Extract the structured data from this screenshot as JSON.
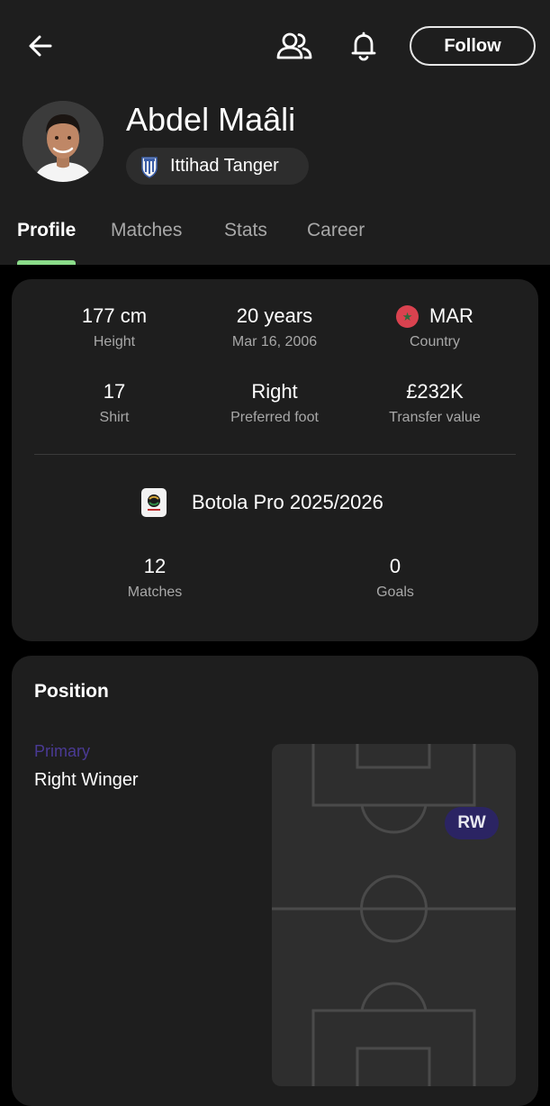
{
  "header": {
    "follow_label": "Follow",
    "player_name": "Abdel Maâli",
    "team_name": "Ittihad Tanger"
  },
  "tabs": [
    {
      "label": "Profile",
      "active": true
    },
    {
      "label": "Matches",
      "active": false
    },
    {
      "label": "Stats",
      "active": false
    },
    {
      "label": "Career",
      "active": false
    }
  ],
  "info": {
    "height": {
      "value": "177 cm",
      "label": "Height"
    },
    "age": {
      "value": "20 years",
      "label": "Mar 16, 2006"
    },
    "country": {
      "value": "MAR",
      "label": "Country"
    },
    "shirt": {
      "value": "17",
      "label": "Shirt"
    },
    "foot": {
      "value": "Right",
      "label": "Preferred foot"
    },
    "transfer": {
      "value": "£232K",
      "label": "Transfer value"
    },
    "league": {
      "name": "Botola Pro 2025/2026"
    },
    "matches": {
      "value": "12",
      "label": "Matches"
    },
    "goals": {
      "value": "0",
      "label": "Goals"
    }
  },
  "position": {
    "title": "Position",
    "primary_label": "Primary",
    "primary_position": "Right Winger",
    "badge": "RW"
  },
  "colors": {
    "background": "#000000",
    "surface": "#1e1e1e",
    "chip": "#2d2d2d",
    "tab_indicator": "#8bdc8a",
    "primary_label": "#4a3a94",
    "position_badge": "#2b2463",
    "pitch": "#2e2e2e",
    "pitch_lines": "#4a4a4a",
    "flag_red": "#d9424f"
  },
  "icons": {
    "back": "arrow-left-icon",
    "people": "people-icon",
    "bell": "bell-icon"
  }
}
